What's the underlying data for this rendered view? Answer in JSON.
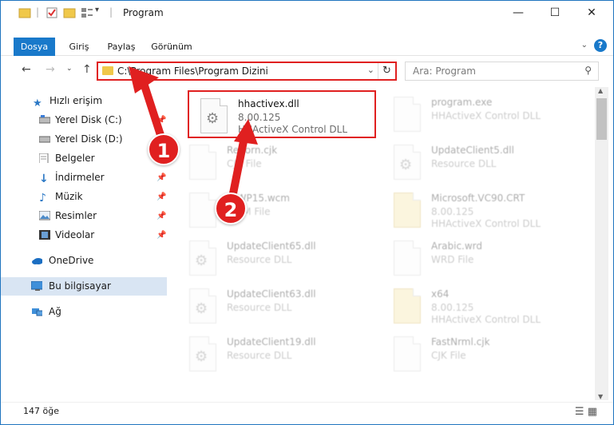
{
  "window": {
    "title": "Program",
    "minimize": "—",
    "maximize": "☐",
    "close": "✕"
  },
  "ribbon": {
    "tabs": [
      "Dosya",
      "Giriş",
      "Paylaş",
      "Görünüm"
    ],
    "help": "?"
  },
  "nav": {
    "path": "C:\\Program Files\\Program Dizini",
    "search_placeholder": "Ara: Program"
  },
  "sidebar": {
    "items": [
      {
        "label": "Hızlı erişim",
        "icon": "star-icon"
      },
      {
        "label": "Yerel Disk (C:)",
        "icon": "drive-icon"
      },
      {
        "label": "Yerel Disk (D:)",
        "icon": "drive-icon"
      },
      {
        "label": "Belgeler",
        "icon": "documents-icon"
      },
      {
        "label": "İndirmeler",
        "icon": "download-icon"
      },
      {
        "label": "Müzik",
        "icon": "music-icon"
      },
      {
        "label": "Resimler",
        "icon": "pictures-icon"
      },
      {
        "label": "Videolar",
        "icon": "videos-icon"
      },
      {
        "label": "OneDrive",
        "icon": "cloud-icon"
      },
      {
        "label": "Bu bilgisayar",
        "icon": "computer-icon"
      },
      {
        "label": "Ağ",
        "icon": "network-icon"
      }
    ]
  },
  "files": [
    {
      "name": "hhactivex.dll",
      "line2": "8.00.125",
      "line3": "HHActiveX Control DLL"
    },
    {
      "name": "program.exe",
      "line2": "",
      "line3": "HHActiveX Control DLL"
    },
    {
      "name": "Reborn.cjk",
      "line2": "CJK File",
      "line3": ""
    },
    {
      "name": "UpdateClient5.dll",
      "line2": "Resource DLL",
      "line3": ""
    },
    {
      "name": "ToWP15.wcm",
      "line2": "WCM File",
      "line3": ""
    },
    {
      "name": "Microsoft.VC90.CRT",
      "line2": "8.00.125",
      "line3": "HHActiveX Control DLL"
    },
    {
      "name": "UpdateClient65.dll",
      "line2": "Resource DLL",
      "line3": ""
    },
    {
      "name": "Arabic.wrd",
      "line2": "WRD File",
      "line3": ""
    },
    {
      "name": "UpdateClient63.dll",
      "line2": "Resource DLL",
      "line3": ""
    },
    {
      "name": "x64",
      "line2": "8.00.125",
      "line3": "HHActiveX Control DLL"
    },
    {
      "name": "UpdateClient19.dll",
      "line2": "Resource DLL",
      "line3": ""
    },
    {
      "name": "FastNrml.cjk",
      "line2": "CJK File",
      "line3": ""
    }
  ],
  "status": {
    "count": "147 öğe"
  },
  "annotations": {
    "badge1": "1",
    "badge2": "2",
    "color": "#e02020"
  }
}
